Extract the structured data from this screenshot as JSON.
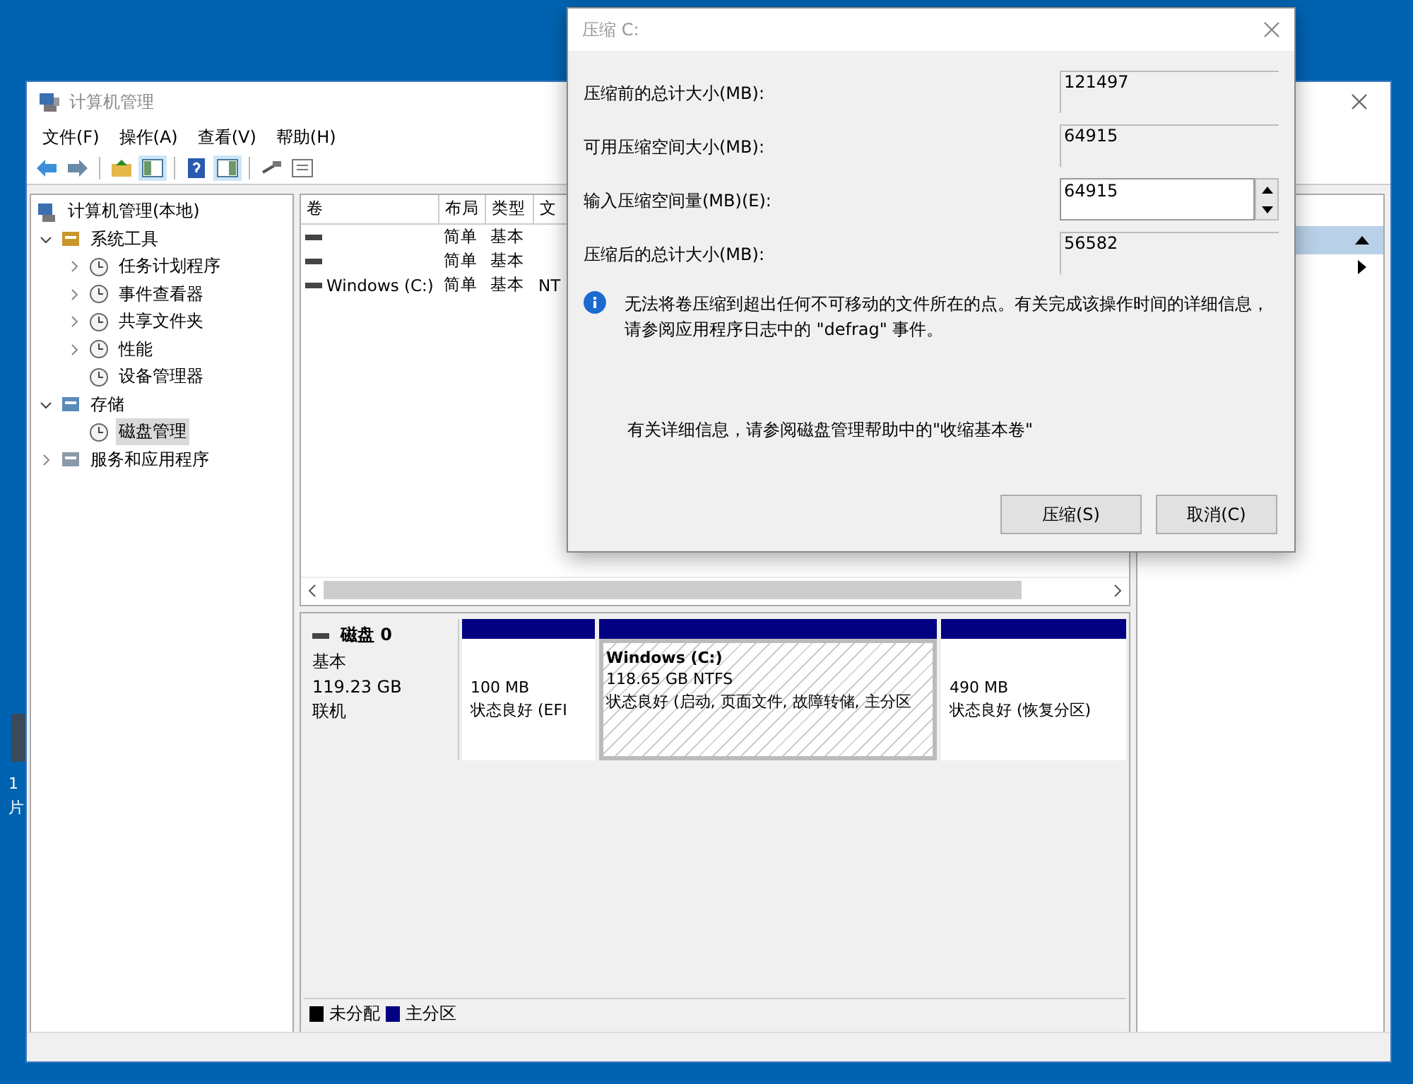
{
  "desktop": {
    "icon_label": [
      "1",
      "片"
    ]
  },
  "window": {
    "title": "计算机管理"
  },
  "menu": [
    "文件(F)",
    "操作(A)",
    "查看(V)",
    "帮助(H)"
  ],
  "toolbar": [
    {
      "kind": "back",
      "selected": false
    },
    {
      "kind": "forward",
      "selected": false
    },
    {
      "kind": "up",
      "selected": false
    },
    {
      "kind": "tree",
      "selected": true
    },
    {
      "kind": "help",
      "selected": false
    },
    {
      "kind": "pane",
      "selected": true
    },
    {
      "kind": "comment",
      "selected": false
    },
    {
      "kind": "list",
      "selected": false
    }
  ],
  "tree": {
    "label": "计算机管理(本地)",
    "selected": false,
    "children": [
      {
        "label": "系统工具",
        "expanded": true,
        "selected": false,
        "children": [
          {
            "label": "任务计划程序",
            "expanded": false,
            "selected": false
          },
          {
            "label": "事件查看器",
            "expanded": false,
            "selected": false
          },
          {
            "label": "共享文件夹",
            "expanded": false,
            "selected": false
          },
          {
            "label": "性能",
            "expanded": false,
            "selected": false
          },
          {
            "label": "设备管理器",
            "selected": false
          }
        ]
      },
      {
        "label": "存储",
        "expanded": true,
        "selected": false,
        "children": [
          {
            "label": "磁盘管理",
            "selected": true
          }
        ]
      },
      {
        "label": "服务和应用程序",
        "expanded": false,
        "selected": false
      }
    ]
  },
  "volumes": {
    "columns": [
      "卷",
      "布局",
      "类型",
      "文"
    ],
    "rows": [
      {
        "layout": "简单",
        "type": "基本"
      },
      {
        "layout": "简单",
        "type": "基本"
      },
      {
        "volume": "Windows (C:)",
        "layout": "简单",
        "type": "基本",
        "column_4": "NT"
      }
    ]
  },
  "disk": {
    "name": "磁盘 0",
    "type": "基本",
    "size": "119.23 GB",
    "status": "联机",
    "partitions": [
      {
        "size": "100 MB",
        "status": "状态良好 (EFI",
        "selected": false,
        "color": "#000080"
      },
      {
        "label": "Windows (C:)",
        "size": "118.65 GB NTFS",
        "status": "状态良好 (启动, 页面文件, 故障转储, 主分区",
        "selected": true,
        "color": "#000080"
      },
      {
        "size": "490 MB",
        "status": "状态良好 (恢复分区)",
        "selected": false,
        "color": "#000080"
      }
    ]
  },
  "legend": [
    {
      "label": "未分配",
      "color": "#000000"
    },
    {
      "label": "主分区",
      "color": "#000080"
    }
  ],
  "action_pane": {
    "header_selected": true
  },
  "dialog": {
    "title": "压缩 C:",
    "fields": [
      {
        "label": "压缩前的总计大小(MB):",
        "value": "121497",
        "kind": "readonly"
      },
      {
        "label": "可用压缩空间大小(MB):",
        "value": "64915",
        "kind": "readonly"
      },
      {
        "label": "输入压缩空间量(MB)(E):",
        "value": "64915",
        "kind": "spinner"
      },
      {
        "label": "压缩后的总计大小(MB):",
        "value": "56582",
        "kind": "readonly"
      }
    ],
    "info": "无法将卷压缩到超出任何不可移动的文件所在的点。有关完成该操作时间的详细信息，请参阅应用程序日志中的 \"defrag\" 事件。",
    "help": "有关详细信息，请参阅磁盘管理帮助中的\"收缩基本卷\"",
    "buttons": [
      "压缩(S)",
      "取消(C)"
    ]
  }
}
